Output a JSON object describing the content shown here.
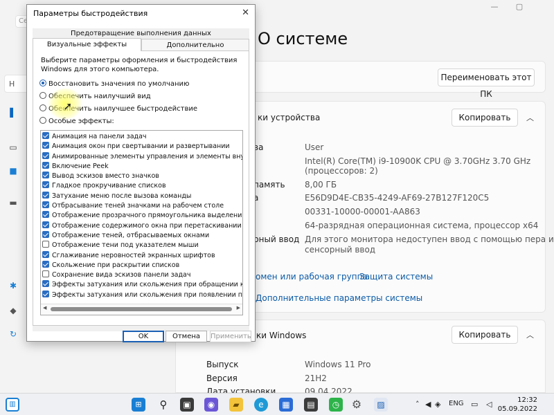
{
  "settings": {
    "page_title": "О системе",
    "rename_button": "Переименовать этот ПК",
    "device_section": {
      "title": "ки устройства",
      "copy_button": "Копировать"
    },
    "specs": [
      {
        "label": "ва",
        "value": "User"
      },
      {
        "label": "",
        "value": "Intel(R) Core(TM) i9-10900K CPU @ 3.70GHz   3.70 GHz"
      },
      {
        "label": "",
        "value": "(процессоров: 2)"
      },
      {
        "label": "память",
        "value": "8,00 ГБ"
      },
      {
        "label": "а",
        "value": "E56D9D4E-CB35-4249-AF69-27B127F120C5"
      },
      {
        "label": "",
        "value": "00331-10000-00001-AA863"
      },
      {
        "label": "",
        "value": "64-разрядная операционная система, процессор x64"
      },
      {
        "label": "рный ввод",
        "value": "Для этого монитора недоступен ввод с помощью пера и"
      },
      {
        "label": "",
        "value": "сенсорный ввод"
      }
    ],
    "links": [
      "омен или рабочая группа",
      "Защита системы",
      "Дополнительные параметры системы"
    ],
    "windows_section": {
      "title": "ки Windows",
      "copy_button": "Копировать"
    },
    "win_specs": [
      {
        "label": "Выпуск",
        "value": "Windows 11 Pro"
      },
      {
        "label": "Версия",
        "value": "21H2"
      },
      {
        "label": "Дата установки",
        "value": "09.04.2022"
      }
    ],
    "left_partial": {
      "tab_se": "Се",
      "tab_n": "Н"
    }
  },
  "dialog": {
    "title": "Параметры быстродействия",
    "tabs_top": "Предотвращение выполнения данных",
    "tabs": [
      "Визуальные эффекты",
      "Дополнительно"
    ],
    "description": "Выберите параметры оформления и быстродействия Windows для этого компьютера.",
    "radios": [
      {
        "label": "Восстановить значения по умолчанию",
        "selected": true
      },
      {
        "label": "Обеспечить наилучший вид",
        "selected": false
      },
      {
        "label": "Обеспечить наилучшее быстродействие",
        "selected": false
      },
      {
        "label": "Особые эффекты:",
        "selected": false
      }
    ],
    "effects": [
      {
        "label": "Анимация на панели задач",
        "checked": true
      },
      {
        "label": "Анимация окон при свертывании и развертывании",
        "checked": true
      },
      {
        "label": "Анимированные элементы управления и элементы внутри окна",
        "checked": true
      },
      {
        "label": "Включение Peek",
        "checked": true
      },
      {
        "label": "Вывод эскизов вместо значков",
        "checked": true
      },
      {
        "label": "Гладкое прокручивание списков",
        "checked": true
      },
      {
        "label": "Затухание меню после вызова команды",
        "checked": true
      },
      {
        "label": "Отбрасывание теней значками на рабочем столе",
        "checked": true
      },
      {
        "label": "Отображение прозрачного прямоугольника выделения",
        "checked": true
      },
      {
        "label": "Отображение содержимого окна при перетаскивании",
        "checked": true
      },
      {
        "label": "Отображение теней, отбрасываемых окнами",
        "checked": true
      },
      {
        "label": "Отображение тени под указателем мыши",
        "checked": false
      },
      {
        "label": "Сглаживание неровностей экранных шрифтов",
        "checked": true
      },
      {
        "label": "Скольжение при раскрытии списков",
        "checked": true
      },
      {
        "label": "Сохранение вида эскизов панели задач",
        "checked": false
      },
      {
        "label": "Эффекты затухания или скольжения при обращении к меню",
        "checked": true
      },
      {
        "label": "Эффекты затухания или скольжения при появлении подсказок",
        "checked": true
      }
    ],
    "buttons": {
      "ok": "OK",
      "cancel": "Отмена",
      "apply": "Применить"
    },
    "close_glyph": "✕"
  },
  "taskbar": {
    "lang": "ENG",
    "time": "12:32",
    "date": "05.09.2022"
  },
  "icons": {
    "window_min": "—",
    "window_max": "▢",
    "chevron_up": "︿"
  }
}
